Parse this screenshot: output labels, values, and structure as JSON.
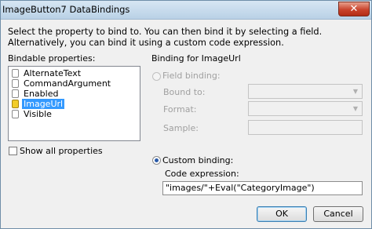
{
  "window": {
    "title": "ImageButton7 DataBindings",
    "close_glyph": "✕"
  },
  "instructions": "Select the property to bind to. You can then bind it by selecting a field. Alternatively, you can bind it using a custom code expression.",
  "bindable": {
    "label": "Bindable properties:",
    "items": [
      {
        "label": "AlternateText",
        "icon": "property-icon"
      },
      {
        "label": "CommandArgument",
        "icon": "property-icon"
      },
      {
        "label": "Enabled",
        "icon": "property-icon"
      },
      {
        "label": "ImageUrl",
        "icon": "bound-property-icon",
        "selected": true
      },
      {
        "label": "Visible",
        "icon": "property-icon"
      }
    ],
    "show_all_label": "Show all properties",
    "show_all_checked": false
  },
  "binding": {
    "group_label": "Binding for ImageUrl",
    "field_binding_label": "Field binding:",
    "bound_to_label": "Bound to:",
    "format_label": "Format:",
    "sample_label": "Sample:",
    "custom_binding_label": "Custom binding:",
    "code_expression_label": "Code expression:",
    "code_expression_value": "\"images/\"+Eval(\"CategoryImage\")",
    "mode": "custom"
  },
  "buttons": {
    "ok": "OK",
    "cancel": "Cancel"
  },
  "colors": {
    "selection": "#3399ff",
    "title_bar": "#c9dcee",
    "close_button": "#c9432c"
  }
}
